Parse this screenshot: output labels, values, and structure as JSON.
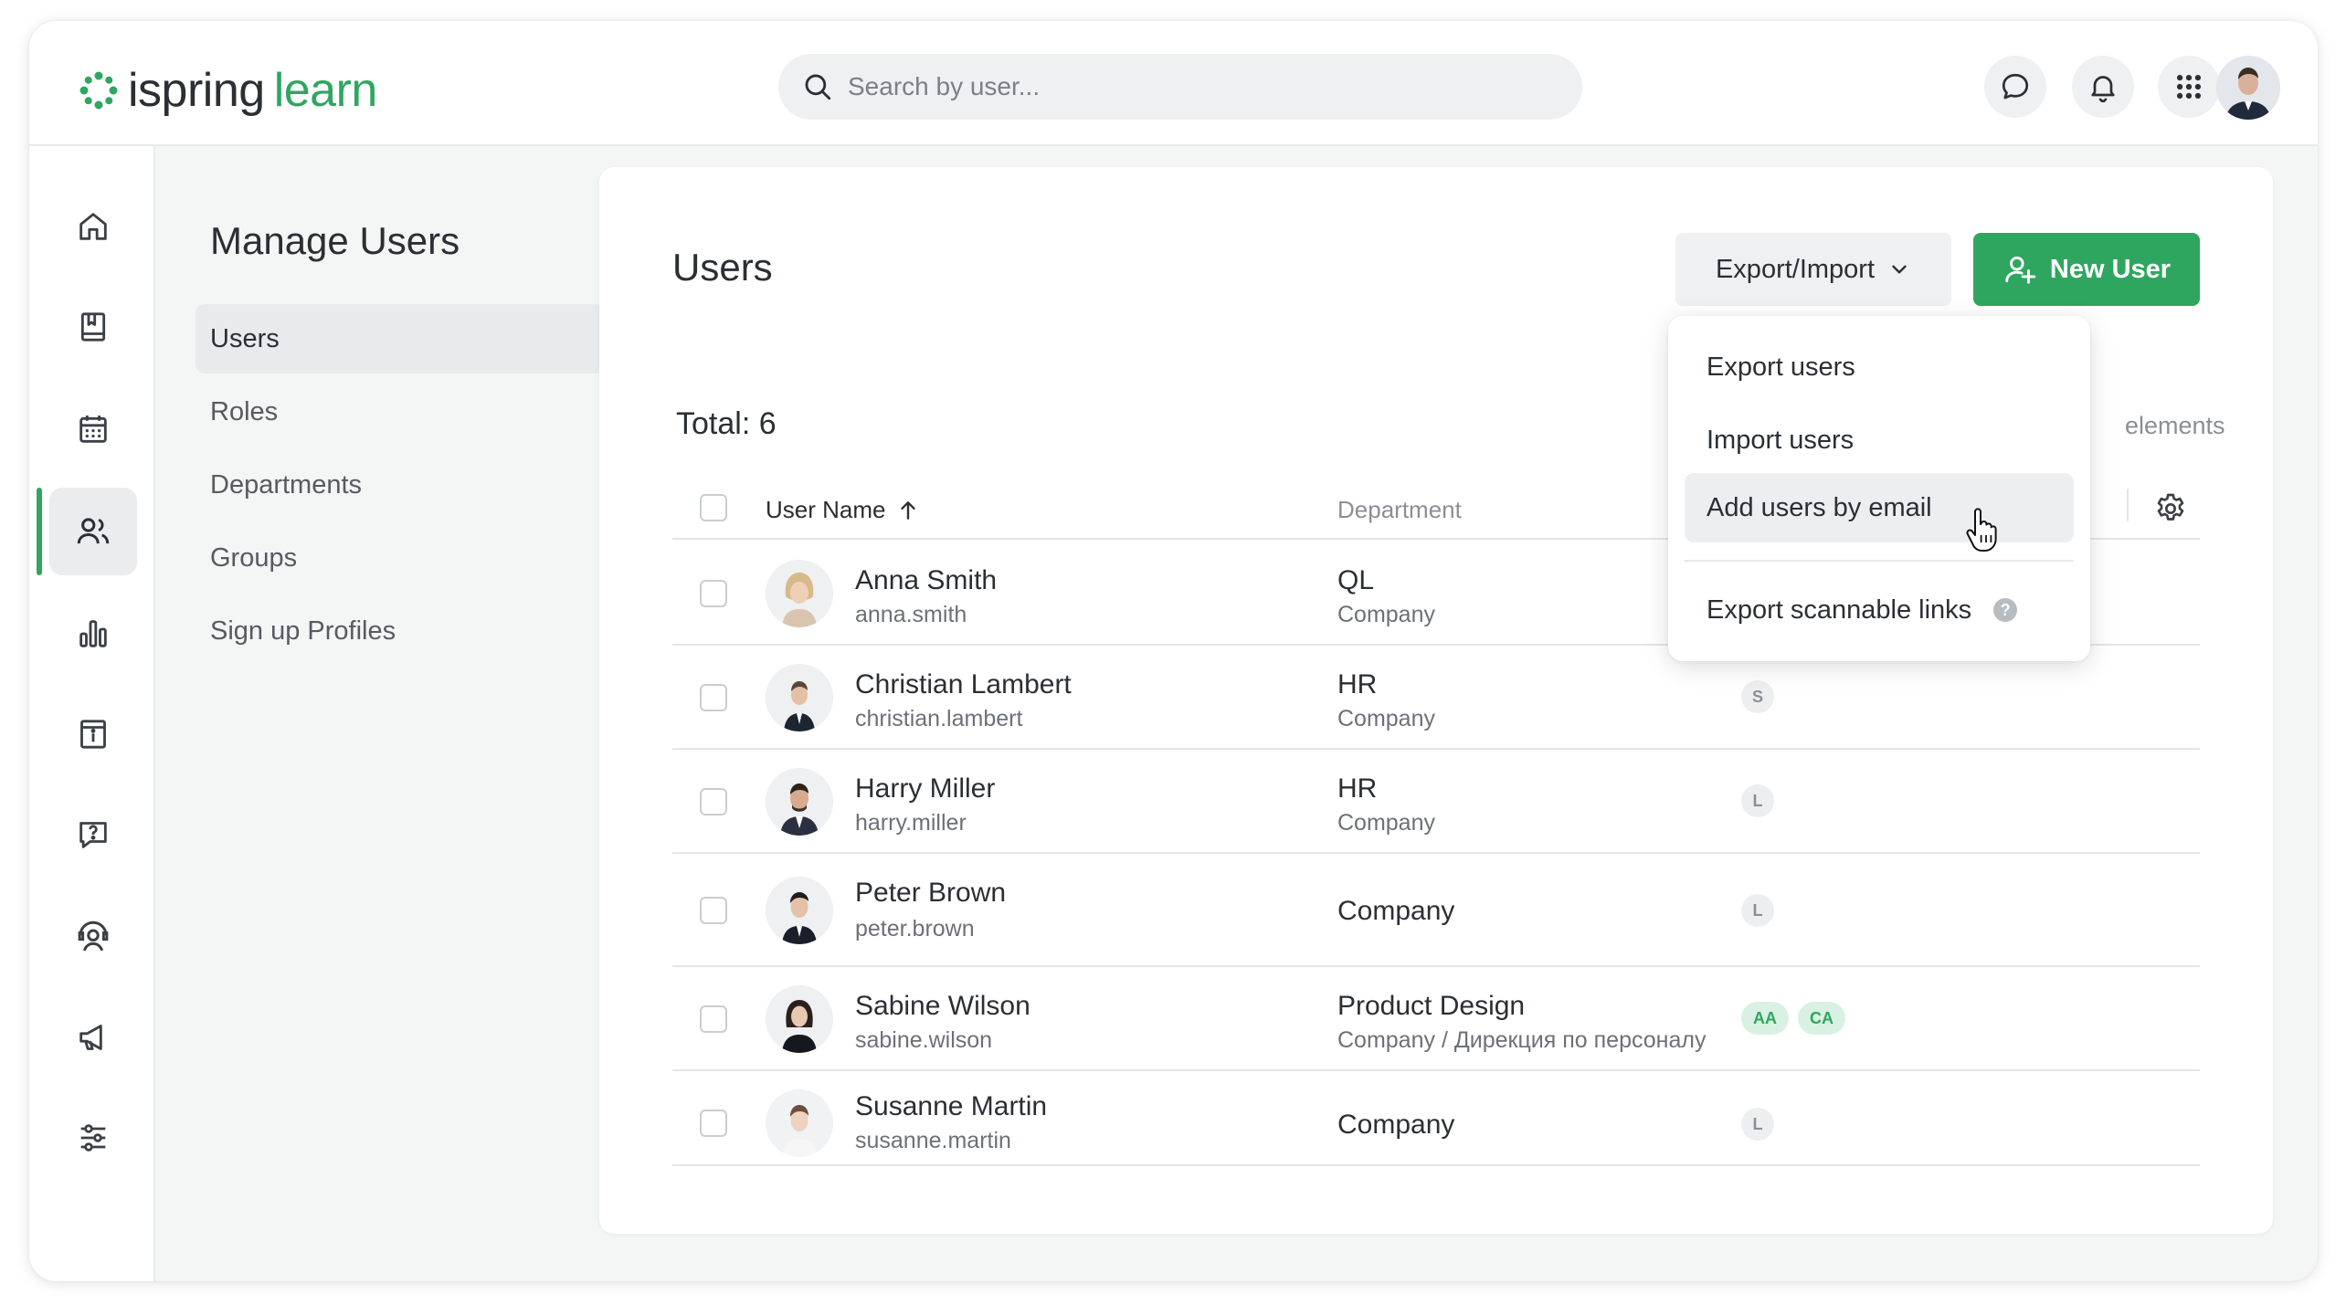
{
  "header": {
    "brand_name": "ispring",
    "brand_product": "learn",
    "search_placeholder": "Search by user..."
  },
  "sidebar": {
    "title": "Manage Users",
    "items": [
      {
        "label": "Users"
      },
      {
        "label": "Roles"
      },
      {
        "label": "Departments"
      },
      {
        "label": "Groups"
      },
      {
        "label": "Sign up Profiles"
      }
    ]
  },
  "main": {
    "title": "Users",
    "export_import_label": "Export/Import",
    "new_user_label": "New User",
    "total_label": "Total: 6",
    "elements_hint": "elements",
    "columns": {
      "name": "User Name",
      "department": "Department"
    }
  },
  "dropdown": {
    "export_users": "Export users",
    "import_users": "Import users",
    "add_by_email": "Add users by email",
    "export_links": "Export scannable links",
    "help": "?"
  },
  "users": [
    {
      "name": "Anna Smith",
      "login": "anna.smith",
      "dept": "QL",
      "path": "Company",
      "badges": []
    },
    {
      "name": "Christian Lambert",
      "login": "christian.lambert",
      "dept": "HR",
      "path": "Company",
      "badges": [
        "S"
      ]
    },
    {
      "name": "Harry Miller",
      "login": "harry.miller",
      "dept": "HR",
      "path": "Company",
      "badges": [
        "L"
      ]
    },
    {
      "name": "Peter Brown",
      "login": "peter.brown",
      "dept": "Company",
      "path": "",
      "badges": [
        "L"
      ]
    },
    {
      "name": "Sabine Wilson",
      "login": "sabine.wilson",
      "dept": "Product Design",
      "path": "Company / Дирекция по персоналу",
      "badges": [
        "AA",
        "CA"
      ]
    },
    {
      "name": "Susanne Martin",
      "login": "susanne.martin",
      "dept": "Company",
      "path": "",
      "badges": [
        "L"
      ]
    }
  ],
  "colors": {
    "accent": "#2fa660",
    "badge_green_bg": "#d8f1e2",
    "badge_grey_bg": "#eceef0"
  }
}
